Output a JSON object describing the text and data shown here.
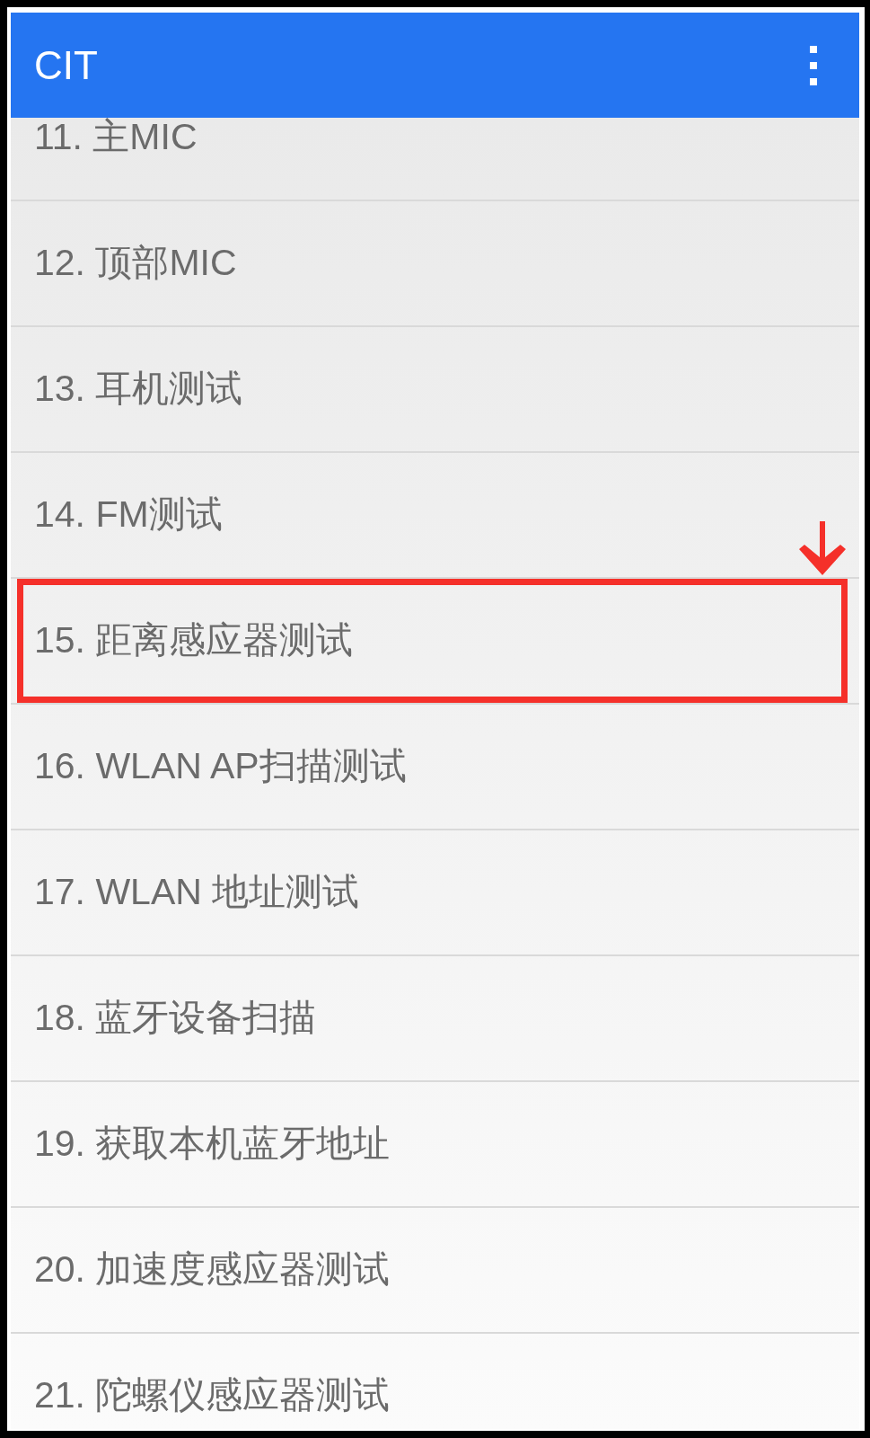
{
  "app_bar": {
    "title": "CIT"
  },
  "list": {
    "items": [
      {
        "label": "11. 主MIC",
        "highlighted": false
      },
      {
        "label": "12. 顶部MIC",
        "highlighted": false
      },
      {
        "label": "13. 耳机测试",
        "highlighted": false
      },
      {
        "label": "14. FM测试",
        "highlighted": false
      },
      {
        "label": "15. 距离感应器测试",
        "highlighted": true
      },
      {
        "label": "16. WLAN AP扫描测试",
        "highlighted": false
      },
      {
        "label": "17. WLAN 地址测试",
        "highlighted": false
      },
      {
        "label": "18. 蓝牙设备扫描",
        "highlighted": false
      },
      {
        "label": "19. 获取本机蓝牙地址",
        "highlighted": false
      },
      {
        "label": "20. 加速度感应器测试",
        "highlighted": false
      },
      {
        "label": "21. 陀螺仪感应器测试",
        "highlighted": false
      }
    ]
  }
}
